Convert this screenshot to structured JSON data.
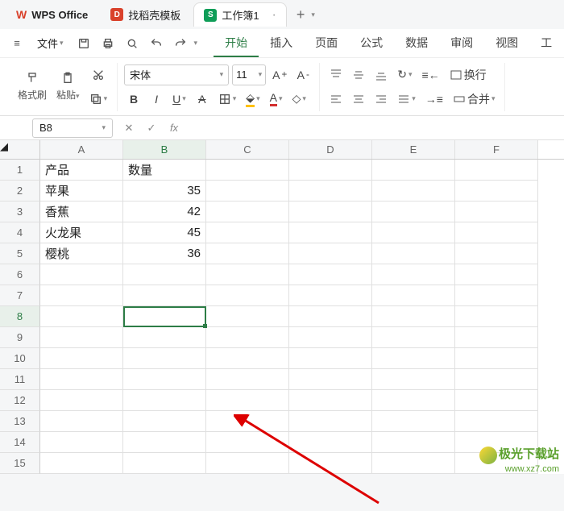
{
  "titlebar": {
    "app_name": "WPS Office",
    "tabs": [
      {
        "label": "找稻壳模板",
        "icon": "D"
      },
      {
        "label": "工作簿1",
        "icon": "S"
      }
    ],
    "add": "+"
  },
  "menubar": {
    "hamburger": "≡",
    "file_label": "文件",
    "tabs": [
      "开始",
      "插入",
      "页面",
      "公式",
      "数据",
      "审阅",
      "视图",
      "工"
    ]
  },
  "ribbon": {
    "brush_label": "格式刷",
    "paste_label": "粘贴",
    "font_name": "宋体",
    "font_size": "11",
    "wrap_label": "换行",
    "merge_label": "合并"
  },
  "namebox": {
    "cell": "B8",
    "fx": "fx"
  },
  "grid": {
    "cols": [
      "A",
      "B",
      "C",
      "D",
      "E",
      "F"
    ],
    "rows": 15,
    "sel_row": 8,
    "sel_col": "B",
    "data": {
      "A1": "产品",
      "B1": "数量",
      "A2": "苹果",
      "B2": "35",
      "A3": "香蕉",
      "B3": "42",
      "A4": "火龙果",
      "B4": "45",
      "A5": "樱桃",
      "B5": "36"
    }
  },
  "watermark": {
    "line1": "极光下载站",
    "line2": "www.xz7.com"
  }
}
